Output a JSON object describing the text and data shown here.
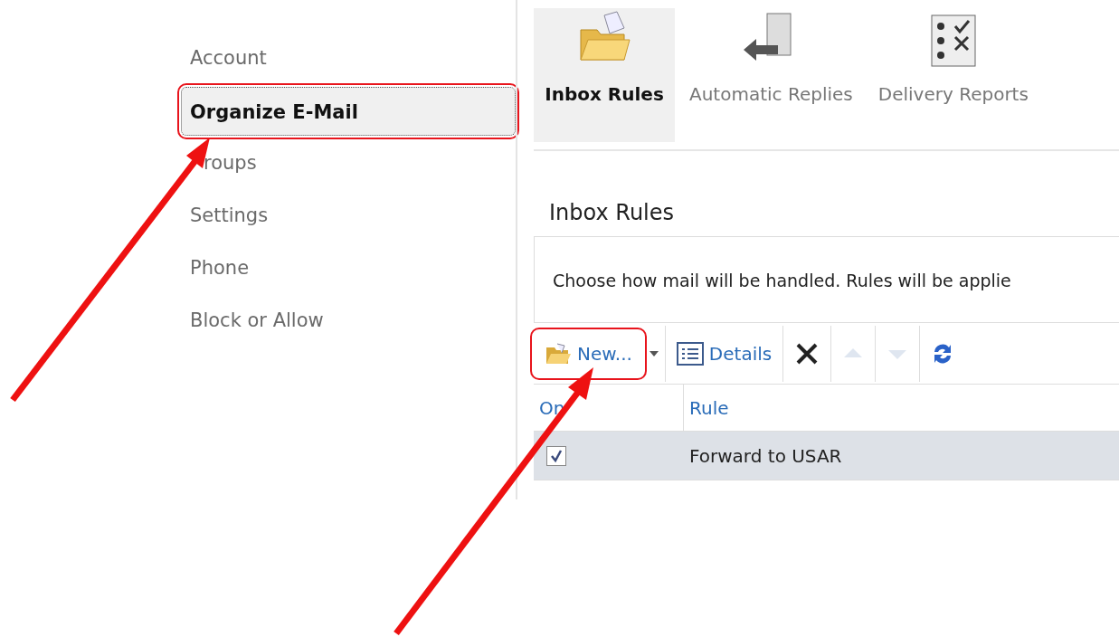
{
  "sidebar": {
    "items": [
      {
        "label": "Account",
        "selected": false,
        "highlighted": false
      },
      {
        "label": "Organize E-Mail",
        "selected": true,
        "highlighted": true
      },
      {
        "label": "roups",
        "selected": false,
        "highlighted": false
      },
      {
        "label": "Settings",
        "selected": false,
        "highlighted": false
      },
      {
        "label": "Phone",
        "selected": false,
        "highlighted": false
      },
      {
        "label": "Block or Allow",
        "selected": false,
        "highlighted": false
      }
    ]
  },
  "tabs": [
    {
      "kind": "rules",
      "label": "Inbox Rules",
      "selected": true
    },
    {
      "kind": "replies",
      "label": "Automatic Replies",
      "selected": false
    },
    {
      "kind": "reports",
      "label": "Delivery Reports",
      "selected": false
    }
  ],
  "section": {
    "title": "Inbox Rules",
    "description": "Choose how mail will be handled. Rules will be applie"
  },
  "toolbar": [
    {
      "kind": "new",
      "label": "New...",
      "disabled": false,
      "highlighted": true
    },
    {
      "kind": "dropdown",
      "disabled": false,
      "highlighted": false
    },
    {
      "kind": "details",
      "label": "Details",
      "disabled": false,
      "highlighted": false
    },
    {
      "kind": "delete",
      "disabled": false,
      "highlighted": false
    },
    {
      "kind": "up",
      "disabled": true,
      "highlighted": false
    },
    {
      "kind": "down",
      "disabled": true,
      "highlighted": false
    },
    {
      "kind": "refresh",
      "disabled": false,
      "highlighted": false
    }
  ],
  "table": {
    "columns": [
      "On",
      "Rule"
    ],
    "rows": [
      {
        "checked": true,
        "rule": "Forward to USAR",
        "selected": true
      }
    ]
  }
}
